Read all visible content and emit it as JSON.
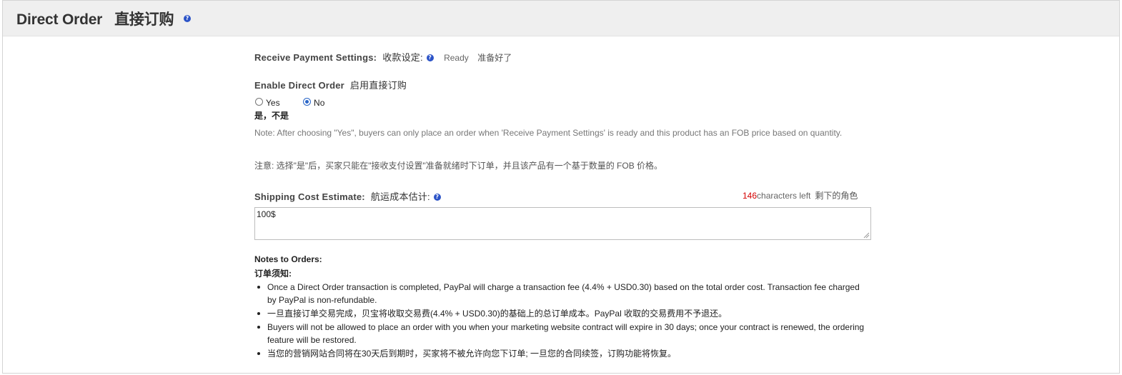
{
  "header": {
    "title": "Direct Order",
    "title_cn": "直接订购",
    "help": "?"
  },
  "payment": {
    "label": "Receive Payment Settings:",
    "label_cn": "收款设定:",
    "help": "?",
    "status": "Ready",
    "status_cn": "准备好了"
  },
  "direct_order": {
    "label": "Enable Direct Order",
    "label_cn": "启用直接订购",
    "options": [
      {
        "label": "Yes",
        "selected": false
      },
      {
        "label": "No",
        "selected": true
      }
    ],
    "options_cn": "是，不是",
    "note": "Note: After choosing \"Yes\", buyers can only place an order when 'Receive Payment Settings' is ready and this product has an FOB price based on quantity.",
    "note_cn": "注意: 选择\"是\"后，买家只能在\"接收支付设置\"准备就绪时下订单，并且该产品有一个基于数量的 FOB 价格。"
  },
  "shipping": {
    "label": "Shipping Cost Estimate:",
    "label_cn": "航运成本估计:",
    "help": "?",
    "chars_left": "146",
    "chars_left_label": "characters left",
    "chars_left_cn": "剩下的角色",
    "value": "100$"
  },
  "notes": {
    "title": "Notes to Orders:",
    "title_cn": "订单须知:",
    "items": [
      "Once a Direct Order transaction is completed, PayPal will charge a transaction fee (4.4% + USD0.30) based on the total order cost. Transaction fee charged by PayPal is non-refundable.",
      "一旦直接订单交易完成，贝宝将收取交易费(4.4% + USD0.30)的基础上的总订单成本。PayPal 收取的交易费用不予退还。",
      "Buyers will not be allowed to place an order with you when your marketing website contract will expire in 30 days; once your contract is renewed, the ordering feature will be restored.",
      "当您的营销网站合同将在30天后到期时，买家将不被允许向您下订单; 一旦您的合同续签，订购功能将恢复。"
    ]
  },
  "colors": {
    "accent": "#2a66c8",
    "counter": "#d40000",
    "header_bg": "#efefef"
  }
}
